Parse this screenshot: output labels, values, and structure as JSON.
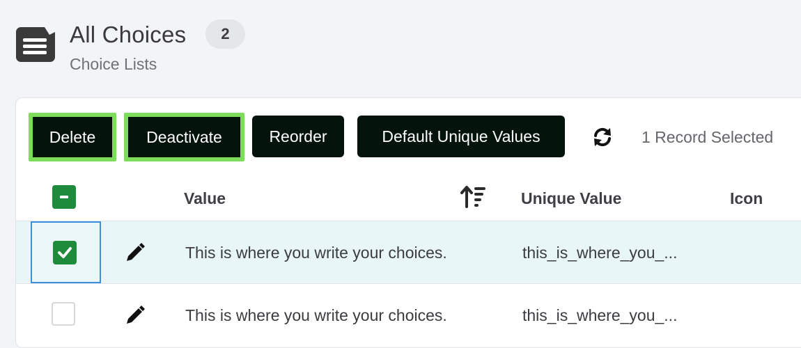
{
  "header": {
    "icon": "list-document-icon",
    "title": "All Choices",
    "count": "2",
    "subtitle": "Choice Lists"
  },
  "toolbar": {
    "delete_label": "Delete",
    "deactivate_label": "Deactivate",
    "reorder_label": "Reorder",
    "default_unique_label": "Default Unique Values",
    "refresh_icon": "refresh-icon",
    "selected_text": "1 Record Selected"
  },
  "table": {
    "columns": [
      "Value",
      "Unique Value",
      "Icon"
    ],
    "rows": [
      {
        "selected": true,
        "value": "This is where you write your choices.",
        "unique_value": "this_is_where_you_..."
      },
      {
        "selected": false,
        "value": "This is where you write your choices.",
        "unique_value": "this_is_where_you_..."
      }
    ]
  },
  "colors": {
    "button_bg": "#04140c",
    "highlight": "#7ddc5a",
    "checkbox_green": "#1e8a3c",
    "selected_row": "#e9f6f7",
    "focus_border": "#3c8fdd"
  }
}
